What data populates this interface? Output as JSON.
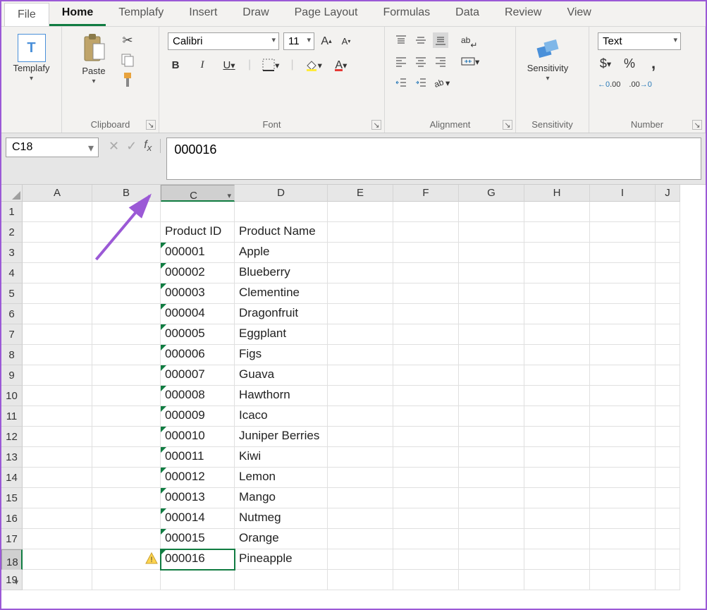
{
  "tabs": [
    "File",
    "Home",
    "Templafy",
    "Insert",
    "Draw",
    "Page Layout",
    "Formulas",
    "Data",
    "Review",
    "View"
  ],
  "active_tab": "Home",
  "ribbon": {
    "templafy": {
      "label": "Templafy"
    },
    "clipboard": {
      "label": "Clipboard",
      "paste": "Paste"
    },
    "font": {
      "label": "Font",
      "family": "Calibri",
      "size": "11",
      "bold": "B",
      "italic": "I",
      "underline": "U"
    },
    "alignment": {
      "label": "Alignment",
      "wrap": "ab"
    },
    "sensitivity": {
      "label": "Sensitivity",
      "btn": "Sensitivity"
    },
    "number": {
      "label": "Number",
      "format": "Text",
      "currency": "$",
      "percent": "%",
      "comma": ",",
      "inc": ".00",
      "dec": ".00"
    }
  },
  "formula_bar": {
    "cell_ref": "C18",
    "value": "000016"
  },
  "sheet": {
    "columns": [
      "A",
      "B",
      "C",
      "D",
      "E",
      "F",
      "G",
      "H",
      "I",
      "J"
    ],
    "selected_col": "C",
    "selected_row": 18,
    "active_cell": "C18",
    "headers": {
      "c": "Product ID",
      "d": "Product Name"
    },
    "data_rows": [
      {
        "id": "000001",
        "name": "Apple"
      },
      {
        "id": "000002",
        "name": "Blueberry"
      },
      {
        "id": "000003",
        "name": "Clementine"
      },
      {
        "id": "000004",
        "name": "Dragonfruit"
      },
      {
        "id": "000005",
        "name": "Eggplant"
      },
      {
        "id": "000006",
        "name": "Figs"
      },
      {
        "id": "000007",
        "name": "Guava"
      },
      {
        "id": "000008",
        "name": "Hawthorn"
      },
      {
        "id": "000009",
        "name": "Icaco"
      },
      {
        "id": "000010",
        "name": "Juniper Berries"
      },
      {
        "id": "000011",
        "name": "Kiwi"
      },
      {
        "id": "000012",
        "name": "Lemon"
      },
      {
        "id": "000013",
        "name": "Mango"
      },
      {
        "id": "000014",
        "name": "Nutmeg"
      },
      {
        "id": "000015",
        "name": "Orange"
      },
      {
        "id": "000016",
        "name": "Pineapple"
      }
    ]
  }
}
